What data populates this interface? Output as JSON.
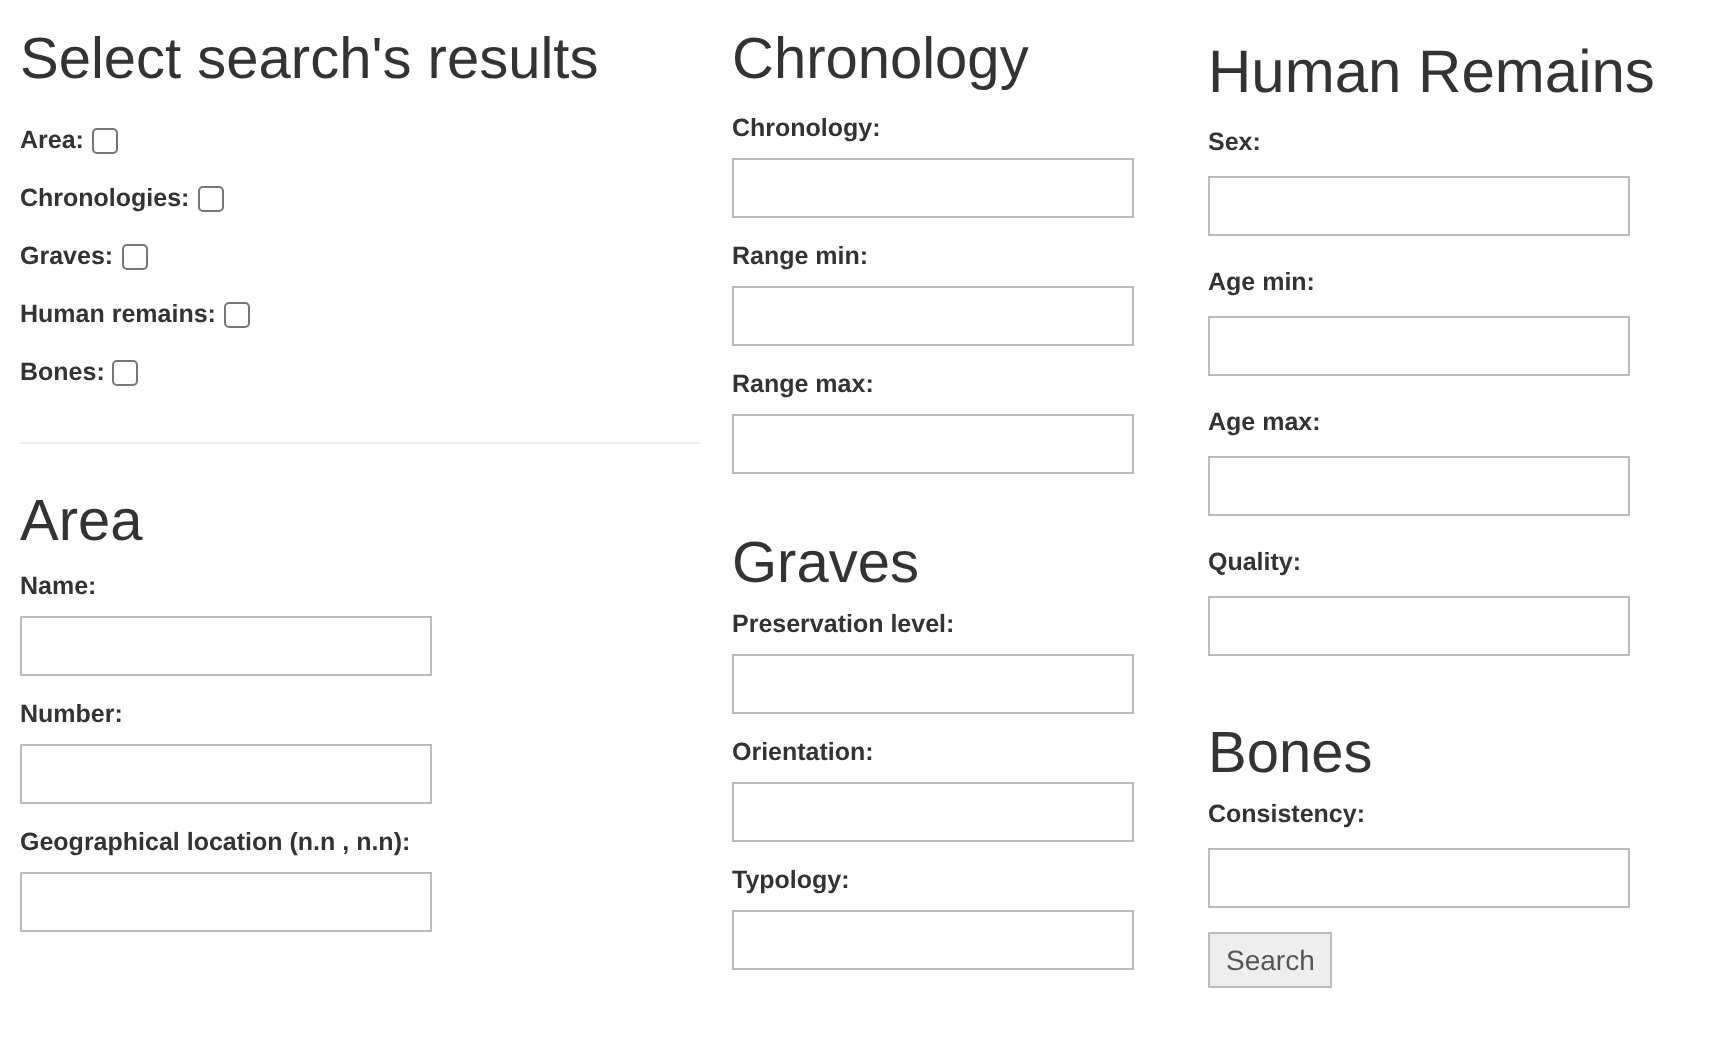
{
  "select_results": {
    "title": "Select search's results",
    "options": [
      {
        "label": "Area:",
        "checked": false
      },
      {
        "label": "Chronologies:",
        "checked": false
      },
      {
        "label": "Graves:",
        "checked": false
      },
      {
        "label": "Human remains:",
        "checked": false
      },
      {
        "label": "Bones:",
        "checked": false
      }
    ]
  },
  "area": {
    "title": "Area",
    "fields": [
      {
        "label": "Name:"
      },
      {
        "label": "Number:"
      },
      {
        "label": "Geographical location (n.n , n.n):"
      }
    ]
  },
  "chronology": {
    "title": "Chronology",
    "fields": [
      {
        "label": "Chronology:"
      },
      {
        "label": "Range min:"
      },
      {
        "label": "Range max:"
      }
    ]
  },
  "graves": {
    "title": "Graves",
    "fields": [
      {
        "label": "Preservation level:"
      },
      {
        "label": "Orientation:"
      },
      {
        "label": "Typology:"
      }
    ]
  },
  "human_remains": {
    "title": "Human Remains",
    "fields": [
      {
        "label": "Sex:"
      },
      {
        "label": "Age min:"
      },
      {
        "label": "Age max:"
      },
      {
        "label": "Quality:"
      }
    ]
  },
  "bones": {
    "title": "Bones",
    "fields": [
      {
        "label": "Consistency:"
      }
    ]
  },
  "search_button": "Search"
}
